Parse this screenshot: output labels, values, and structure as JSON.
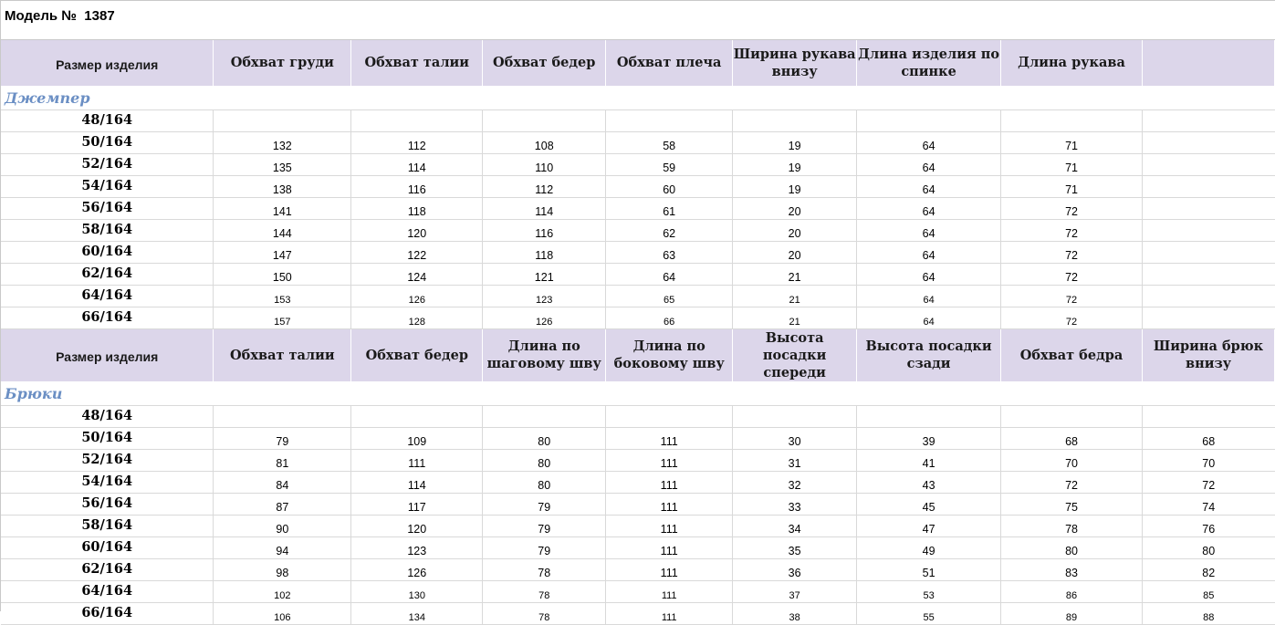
{
  "title": "Модель №  1387",
  "jumper": {
    "header": [
      "Размер изделия",
      "Обхват груди",
      "Обхват талии",
      "Обхват бедер",
      "Обхват плеча",
      "Ширина рукава внизу",
      "Длина изделия по спинке",
      "Длина рукава",
      ""
    ],
    "section_label": "Джемпер",
    "rows": [
      [
        "48/164",
        "",
        "",
        "",
        "",
        "",
        "",
        "",
        ""
      ],
      [
        "50/164",
        "132",
        "112",
        "108",
        "58",
        "19",
        "64",
        "71",
        ""
      ],
      [
        "52/164",
        "135",
        "114",
        "110",
        "59",
        "19",
        "64",
        "71",
        ""
      ],
      [
        "54/164",
        "138",
        "116",
        "112",
        "60",
        "19",
        "64",
        "71",
        ""
      ],
      [
        "56/164",
        "141",
        "118",
        "114",
        "61",
        "20",
        "64",
        "72",
        ""
      ],
      [
        "58/164",
        "144",
        "120",
        "116",
        "62",
        "20",
        "64",
        "72",
        ""
      ],
      [
        "60/164",
        "147",
        "122",
        "118",
        "63",
        "20",
        "64",
        "72",
        ""
      ],
      [
        "62/164",
        "150",
        "124",
        "121",
        "64",
        "21",
        "64",
        "72",
        ""
      ],
      [
        "64/164",
        "153",
        "126",
        "123",
        "65",
        "21",
        "64",
        "72",
        ""
      ],
      [
        "66/164",
        "157",
        "128",
        "126",
        "66",
        "21",
        "64",
        "72",
        ""
      ]
    ]
  },
  "trousers": {
    "header": [
      "Размер изделия",
      "Обхват талии",
      "Обхват бедер",
      "Длина по шаговому шву",
      "Длина по боковому шву",
      "Высота посадки спереди",
      "Высота посадки сзади",
      "Обхват бедра",
      "Ширина брюк внизу"
    ],
    "section_label": "Брюки",
    "rows": [
      [
        "48/164",
        "",
        "",
        "",
        "",
        "",
        "",
        "",
        ""
      ],
      [
        "50/164",
        "79",
        "109",
        "80",
        "111",
        "30",
        "39",
        "68",
        "68"
      ],
      [
        "52/164",
        "81",
        "111",
        "80",
        "111",
        "31",
        "41",
        "70",
        "70"
      ],
      [
        "54/164",
        "84",
        "114",
        "80",
        "111",
        "32",
        "43",
        "72",
        "72"
      ],
      [
        "56/164",
        "87",
        "117",
        "79",
        "111",
        "33",
        "45",
        "75",
        "74"
      ],
      [
        "58/164",
        "90",
        "120",
        "79",
        "111",
        "34",
        "47",
        "78",
        "76"
      ],
      [
        "60/164",
        "94",
        "123",
        "79",
        "111",
        "35",
        "49",
        "80",
        "80"
      ],
      [
        "62/164",
        "98",
        "126",
        "78",
        "111",
        "36",
        "51",
        "83",
        "82"
      ],
      [
        "64/164",
        "102",
        "130",
        "78",
        "111",
        "37",
        "53",
        "86",
        "85"
      ],
      [
        "66/164",
        "106",
        "134",
        "78",
        "111",
        "38",
        "55",
        "89",
        "88"
      ]
    ]
  },
  "colors": {
    "header_bg": "#dcd6ea",
    "section_label": "#6b8fc4",
    "gridline": "#d9d9d9"
  }
}
